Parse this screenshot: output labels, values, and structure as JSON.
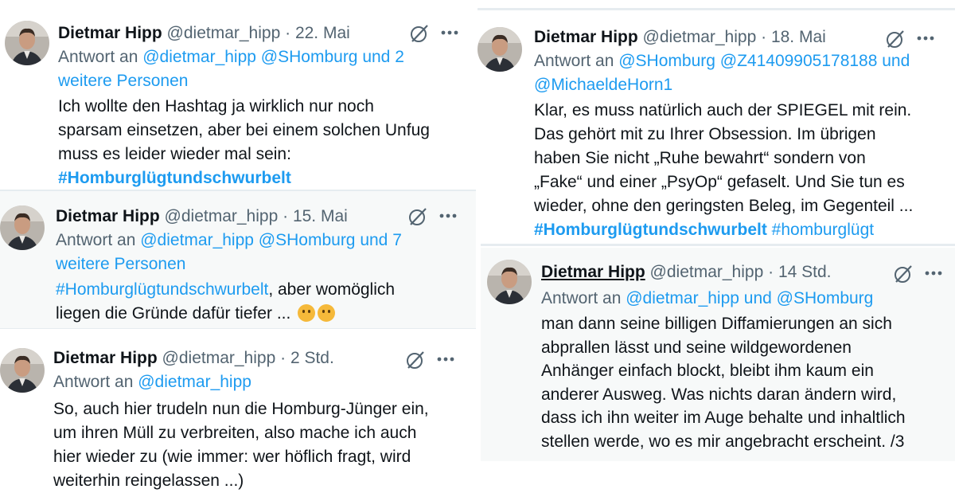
{
  "tweets": [
    {
      "name": "Dietmar Hipp",
      "handle": "@dietmar_hipp",
      "sep": "·",
      "time": "22. Mai",
      "reply_prefix": "Antwort an",
      "reply_line1": "@dietmar_hipp @SHomburg und 2",
      "reply_line2": "weitere Personen",
      "line1": "Ich wollte den Hashtag ja wirklich nur noch",
      "line2": "sparsam einsetzen, aber bei einem solchen Unfug",
      "line3": "muss es leider wieder mal sein:",
      "hashtag": "#Homburglügtundschwurbelt"
    },
    {
      "name": "Dietmar Hipp",
      "handle": "@dietmar_hipp",
      "sep": "·",
      "time": "15. Mai",
      "reply_prefix": "Antwort an",
      "reply_line1": "@dietmar_hipp @SHomburg und 7",
      "reply_line2": "weitere Personen",
      "hashtag": "#Homburglügtundschwurbelt",
      "line1_rest": ", aber womöglich",
      "line2": "liegen die Gründe dafür tiefer ...",
      "emojis": [
        "face-with-hand-over-mouth",
        "sad-but-relieved-face"
      ]
    },
    {
      "name": "Dietmar Hipp",
      "handle": "@dietmar_hipp",
      "sep": "·",
      "time": "2 Std.",
      "reply_prefix": "Antwort an",
      "reply_line1": "@dietmar_hipp",
      "line1": "So, auch hier trudeln nun die Homburg-Jünger ein,",
      "line2": "um ihren Müll zu verbreiten, also mache ich auch",
      "line3": "hier wieder zu (wie immer: wer höflich fragt, wird",
      "line4": "weiterhin reingelassen ...)"
    },
    {
      "name": "Dietmar Hipp",
      "handle": "@dietmar_hipp",
      "sep": "·",
      "time": "18. Mai",
      "reply_prefix": "Antwort an",
      "reply_line1": "@SHomburg @Z41409905178188 und",
      "reply_line2": "@MichaeldeHorn1",
      "line1": "Klar, es muss natürlich auch der SPIEGEL mit rein.",
      "line2": "Das gehört mit zu Ihrer Obsession. Im übrigen",
      "line3": "haben Sie nicht „Ruhe bewahrt“ sondern von",
      "line4": "„Fake“ und einer „PsyOp“ gefaselt. Und Sie tun es",
      "line5": "wieder, ohne den geringsten Beleg, im Gegenteil ...",
      "hashtag1": "#Homburglügtundschwurbelt",
      "hashtag2": "#homburglügt"
    },
    {
      "name": "Dietmar Hipp",
      "handle": "@dietmar_hipp",
      "sep": "·",
      "time": "14 Std.",
      "reply_prefix": "Antwort an",
      "reply_line1": "@dietmar_hipp und @SHomburg",
      "line1": "man dann seine billigen Diffamierungen an sich",
      "line2": "abprallen lässt und seine wildgewordenen",
      "line3": "Anhänger einfach blockt, bleibt ihm kaum ein",
      "line4": "anderer Ausweg. Was nichts daran ändern wird,",
      "line5": "dass ich ihn weiter im Auge behalte und inhaltlich",
      "line6": "stellen werde, wo es mir angebracht erscheint. /3"
    }
  ],
  "icons": {
    "grok": "grok-icon",
    "more": "more-options-icon"
  },
  "colors": {
    "link": "#1d9bf0",
    "meta": "#536471",
    "text": "#0f1419",
    "divider": "#e6ecf0",
    "panel_bg": "#f7f9f9"
  }
}
